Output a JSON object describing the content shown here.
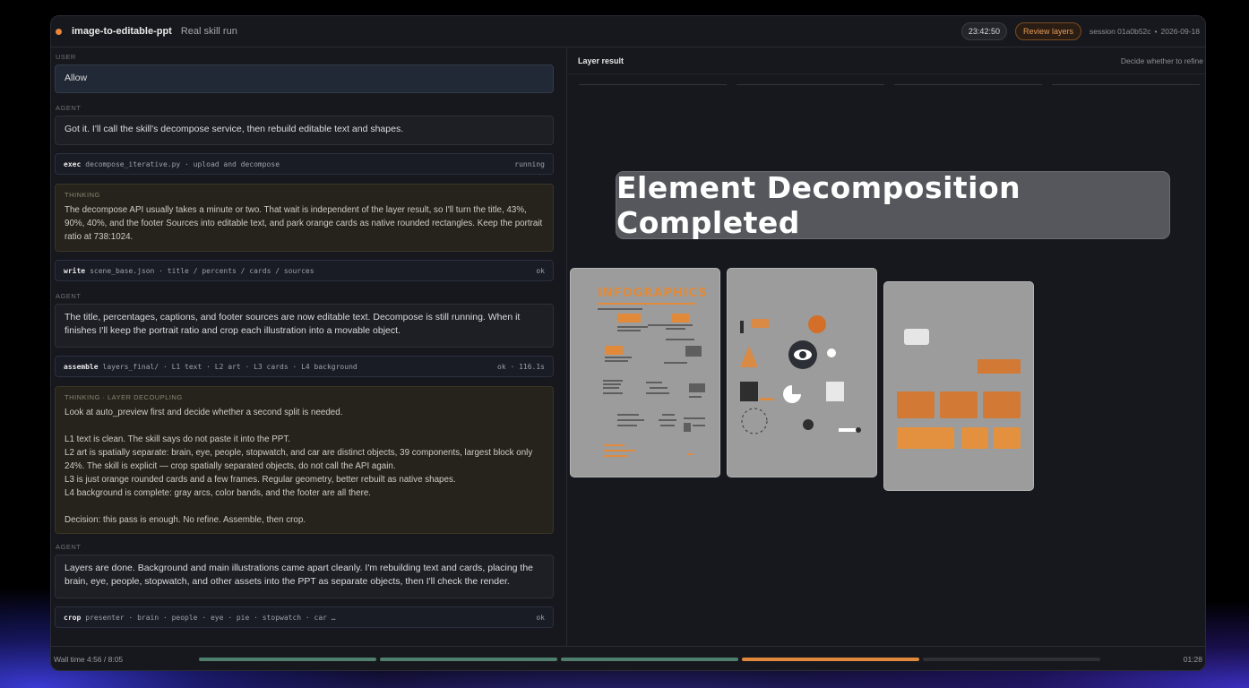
{
  "header": {
    "app_name": "image-to-editable-ppt",
    "subtitle": "Real skill run",
    "clock": "23:42:50",
    "review_button": "Review layers",
    "session": "session 01a0b52c",
    "date": "2026-09-18",
    "separator": "•"
  },
  "conversation": {
    "user_role": "USER",
    "user_message": "Allow",
    "agent_role": "AGENT",
    "agent_msg_1": "Got it. I'll call the skill's decompose service, then rebuild editable text and shapes.",
    "cmd_1": {
      "verb": "exec",
      "args": "decompose_iterative.py · upload and decompose",
      "status": "running"
    },
    "thinking_1": {
      "label": "THINKING",
      "text": "The decompose API usually takes a minute or two. That wait is independent of the layer result, so I'll turn the title, 43%, 90%, 40%, and the footer Sources into editable text, and park orange cards as native rounded rectangles. Keep the portrait ratio at 738:1024."
    },
    "cmd_2": {
      "verb": "write",
      "args": "scene_base.json · title / percents / cards / sources",
      "status": "ok"
    },
    "agent_msg_2": "The title, percentages, captions, and footer sources are now editable text. Decompose is still running. When it finishes I'll keep the portrait ratio and crop each illustration into a movable object.",
    "cmd_3": {
      "verb": "assemble",
      "args": "layers_final/ · L1 text · L2 art · L3 cards · L4 background",
      "status": "ok · 116.1s"
    },
    "thinking_2": {
      "label": "THINKING · LAYER DECOUPLING",
      "line_1": "Look at auto_preview first and decide whether a second split is needed.",
      "line_2": "L1 text is clean. The skill says do not paste it into the PPT.",
      "line_3": "L2 art is spatially separate: brain, eye, people, stopwatch, and car are distinct objects, 39 components, largest block only 24%. The skill is explicit — crop spatially separated objects, do not call the API again.",
      "line_4": "L3 is just orange rounded cards and a few frames. Regular geometry, better rebuilt as native shapes.",
      "line_5": "L4 background is complete: gray arcs, color bands, and the footer are all there.",
      "line_6": "Decision: this pass is enough. No refine. Assemble, then crop."
    },
    "agent_msg_3": "Layers are done. Background and main illustrations came apart cleanly. I'm rebuilding text and cards, placing the brain, eye, people, stopwatch, and other assets into the PPT as separate objects, then I'll check the render.",
    "cmd_4": {
      "verb": "crop",
      "args": "presenter · brain · people · eye · pie · stopwatch · car …",
      "status": "ok"
    }
  },
  "layer_panel": {
    "title": "Layer result",
    "hint": "Decide whether to refine",
    "overlay": "Element Decomposition Completed",
    "thumb1_heading": "INFOGRAPHICS"
  },
  "statusbar": {
    "wall_time": "Wall time 4:56 / 8:05",
    "elapsed": "01:28",
    "segments": [
      {
        "state": "done",
        "color": "#4f7f6c"
      },
      {
        "state": "done",
        "color": "#4f7f6c"
      },
      {
        "state": "done",
        "color": "#4f7f6c"
      },
      {
        "state": "active",
        "color": "#e0883c"
      },
      {
        "state": "pending",
        "color": "#2e3036"
      }
    ]
  },
  "colors": {
    "accent": "#e8853c",
    "done": "#4f7f6c",
    "thumb_bg": "#9c9c9c"
  }
}
